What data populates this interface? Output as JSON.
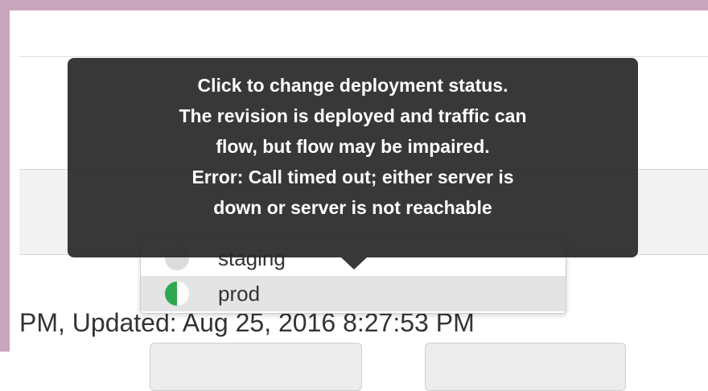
{
  "tooltip": {
    "lines": [
      "Click to change deployment status.",
      "The revision is deployed and traffic can",
      "flow, but flow may be impaired.",
      "Error: Call timed out; either server is",
      "down or server is not reachable"
    ]
  },
  "environments": [
    {
      "label": "staging",
      "status_icon": "grey-circle-icon"
    },
    {
      "label": "prod",
      "status_icon": "half-green-circle-icon",
      "selected": true
    }
  ],
  "footer": {
    "timestamp_text": "PM, Updated: Aug 25, 2016 8:27:53 PM"
  },
  "colors": {
    "frame": "#c9a5bc",
    "tooltip_bg": "#2c2c2c",
    "status_green": "#2fa84f"
  }
}
